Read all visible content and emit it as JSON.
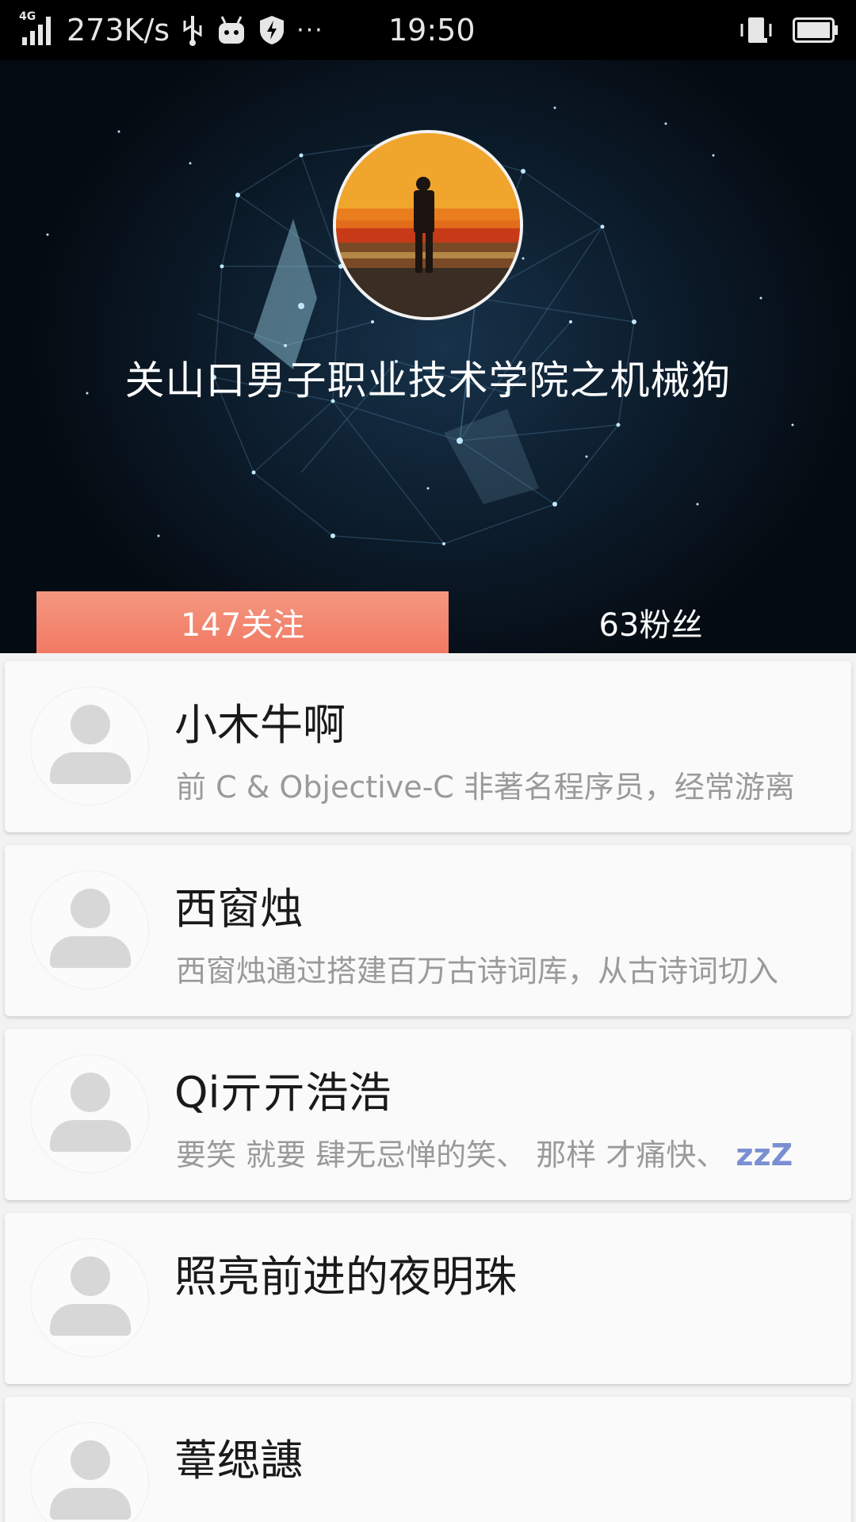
{
  "status_bar": {
    "network_type": "4G",
    "speed": "273K/s",
    "more": "···",
    "time": "19:50"
  },
  "profile": {
    "username": "关山口男子职业技术学院之机械狗",
    "tabs": {
      "following": "147关注",
      "fans": "63粉丝"
    }
  },
  "users": [
    {
      "name": "小木牛啊",
      "bio": "前 C & Objective-C 非著名程序员，经常游离"
    },
    {
      "name": "西窗烛",
      "bio": "西窗烛通过搭建百万古诗词库，从古诗词切入"
    },
    {
      "name": "Qi亓亓浩浩",
      "bio": "要笑 就要 肆无忌惮的笑、 那样 才痛快、",
      "bio_suffix": "zzZ"
    },
    {
      "name": "照亮前进的夜明珠",
      "bio": ""
    },
    {
      "name": "葦缌譓",
      "bio": ""
    }
  ],
  "icons": {
    "signal": "signal-icon",
    "usb": "usb-icon",
    "android": "android-icon",
    "shield": "shield-icon",
    "vibrate": "vibrate-icon",
    "battery": "battery-icon",
    "avatar": "default-avatar-icon"
  },
  "colors": {
    "tab_active": "#f27963",
    "status_bar": "#000000",
    "name_text": "#1a1a1a",
    "bio_text": "#9a9a9a"
  }
}
